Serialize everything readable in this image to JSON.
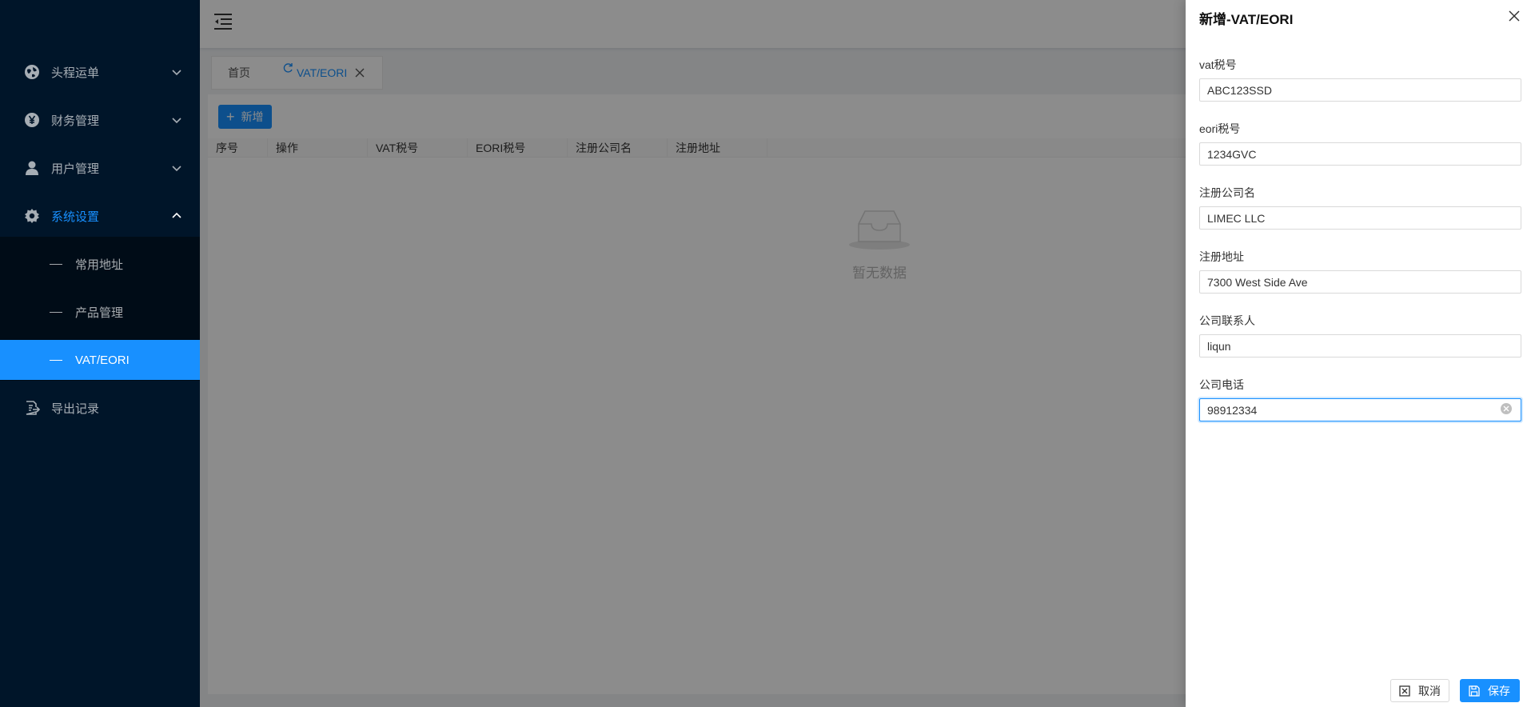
{
  "sidebar": {
    "items": [
      {
        "label": "头程运单",
        "icon": "globe-icon"
      },
      {
        "label": "财务管理",
        "icon": "yen-icon"
      },
      {
        "label": "用户管理",
        "icon": "user-icon"
      },
      {
        "label": "系统设置",
        "icon": "gear-icon"
      },
      {
        "label": "导出记录",
        "icon": "export-icon"
      }
    ],
    "subitems": [
      {
        "label": "常用地址"
      },
      {
        "label": "产品管理"
      },
      {
        "label": "VAT/EORI"
      }
    ],
    "active_color": "#1890ff",
    "bg_color": "#001529"
  },
  "tabs": [
    {
      "label": "首页"
    },
    {
      "label": "VAT/EORI"
    }
  ],
  "content": {
    "add_label": "新增",
    "columns": [
      "序号",
      "操作",
      "VAT税号",
      "EORI税号",
      "注册公司名",
      "注册地址"
    ],
    "empty_text": "暂无数据"
  },
  "drawer": {
    "title": "新增-VAT/EORI",
    "fields": [
      {
        "label": "vat税号",
        "value": "ABC123SSD"
      },
      {
        "label": "eori税号",
        "value": "1234GVC"
      },
      {
        "label": "注册公司名",
        "value": "LIMEC LLC"
      },
      {
        "label": "注册地址",
        "value": "7300 West Side Ave"
      },
      {
        "label": "公司联系人",
        "value": "liqun"
      },
      {
        "label": "公司电话",
        "value": "98912334"
      }
    ],
    "cancel_label": "取消",
    "save_label": "保存"
  }
}
